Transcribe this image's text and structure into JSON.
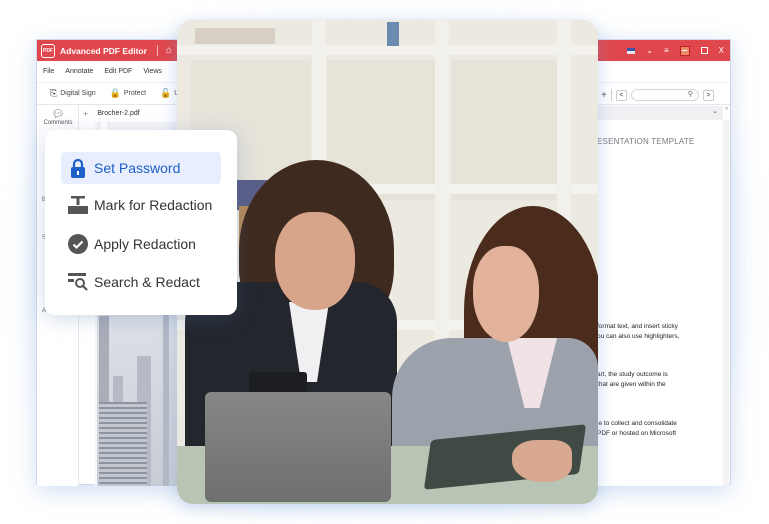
{
  "app": {
    "title": "Advanced PDF Editor",
    "logo_text": "PDF",
    "menu": [
      "File",
      "Annotate",
      "Edit PDF",
      "Views"
    ],
    "toolbar": [
      {
        "label": "Digital Sign",
        "icon": "digital-sign-icon",
        "glyph": "⎘"
      },
      {
        "label": "Protect",
        "icon": "lock-icon",
        "glyph": "🔒"
      },
      {
        "label": "U",
        "icon": "unlock-icon",
        "glyph": "🔓"
      }
    ],
    "rail": {
      "comments_label": "Comments",
      "glyphs": [
        "B",
        "S",
        "A"
      ]
    },
    "tab": {
      "label": "Brocher-2.pdf"
    },
    "window_controls": {
      "language": "en-US",
      "chevron": "⌄",
      "menu": "≡",
      "close": "X"
    },
    "nav": {
      "plus": "+",
      "prev": "<",
      "next": ">",
      "search_placeholder": ""
    },
    "collapse_glyph": "«",
    "tabstrip_chevron": "⌄",
    "document": {
      "heading": "ESENTATION TEMPLATE",
      "paragraphs": [
        [
          "format text, and insert sticky",
          "ou can also use highlighters,"
        ],
        [
          "art, the study outcome is",
          "that are given within the"
        ],
        [
          "le to collect and consolidate",
          "PDF or hosted on Microsoft"
        ]
      ]
    }
  },
  "popup_menu": {
    "items": [
      {
        "label": "Set Password",
        "icon": "lock-icon",
        "active": true
      },
      {
        "label": "Mark for Redaction",
        "icon": "mark-redaction-icon",
        "active": false
      },
      {
        "label": "Apply Redaction",
        "icon": "check-circle-icon",
        "active": false
      },
      {
        "label": "Search & Redact",
        "icon": "search-redact-icon",
        "active": false
      }
    ]
  },
  "colors": {
    "brand_red": "#e0474c",
    "accent_blue": "#1f5fc9",
    "active_bg": "#e8eefd",
    "icon_gray": "#555555"
  },
  "photo": {
    "description": "two women collaborating at a laptop in an office"
  }
}
